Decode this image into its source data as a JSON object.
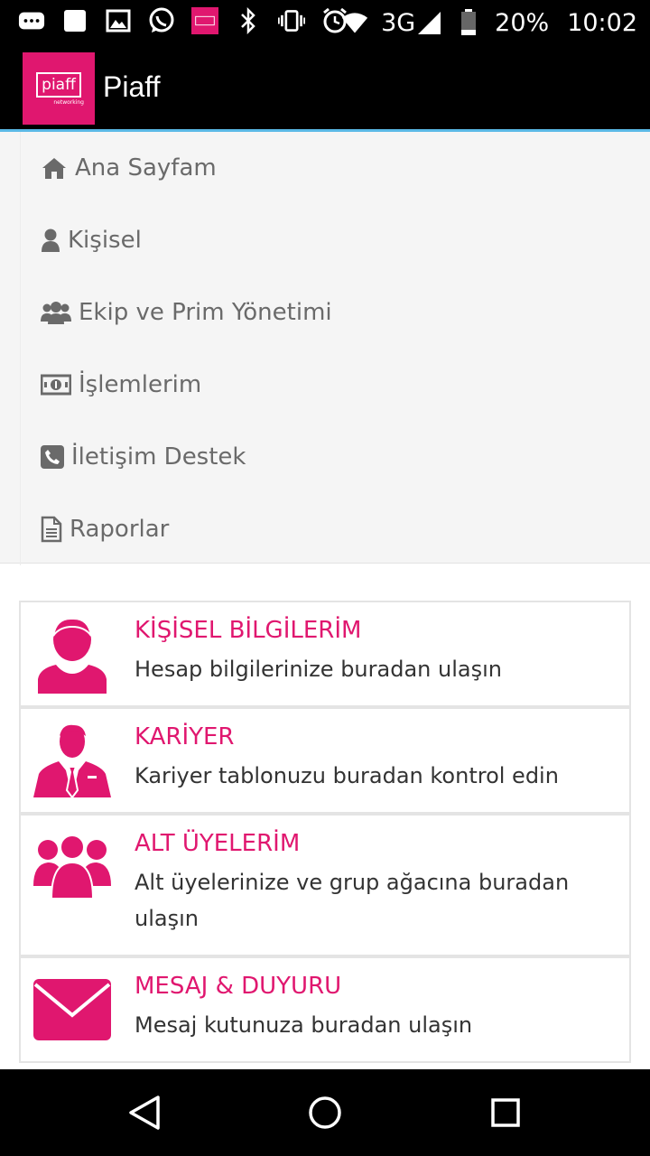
{
  "status_bar": {
    "network": "3G",
    "battery": "20%",
    "time": "10:02",
    "icons": [
      "bbm-icon",
      "square-icon",
      "image-icon",
      "whatsapp-icon",
      "piaff-notification-icon",
      "bluetooth-icon",
      "vibrate-icon",
      "alarm-icon",
      "wifi-icon",
      "signal-icon",
      "battery-icon"
    ]
  },
  "app_bar": {
    "logo_text": "piaff",
    "logo_subtext": "networking",
    "title": "Piaff",
    "accent_color": "#e0176f",
    "divider_color": "#5bb9e6"
  },
  "menu": {
    "items": [
      {
        "label": "Ana Sayfam",
        "icon": "home-icon"
      },
      {
        "label": "Kişisel",
        "icon": "user-icon"
      },
      {
        "label": "Ekip ve Prim Yönetimi",
        "icon": "users-icon"
      },
      {
        "label": "İşlemlerim",
        "icon": "money-icon"
      },
      {
        "label": "İletişim Destek",
        "icon": "phone-icon"
      },
      {
        "label": "Raporlar",
        "icon": "document-icon"
      }
    ]
  },
  "cards": [
    {
      "title": "KİŞİSEL BİLGİLERİM",
      "description": "Hesap bilgilerinize buradan ulaşın",
      "icon": "user-avatar-icon"
    },
    {
      "title": "KARİYER",
      "description": "Kariyer tablonuzu buradan kontrol edin",
      "icon": "businessman-icon"
    },
    {
      "title": "ALT ÜYELERİM",
      "description": "Alt üyelerinize ve grup ağacına buradan ulaşın",
      "icon": "group-icon"
    },
    {
      "title": "MESAJ & DUYURU",
      "description": "Mesaj kutunuza buradan ulaşın",
      "icon": "envelope-icon"
    }
  ],
  "nav_bar": {
    "buttons": [
      "back-icon",
      "home-circle-icon",
      "recents-icon"
    ]
  }
}
